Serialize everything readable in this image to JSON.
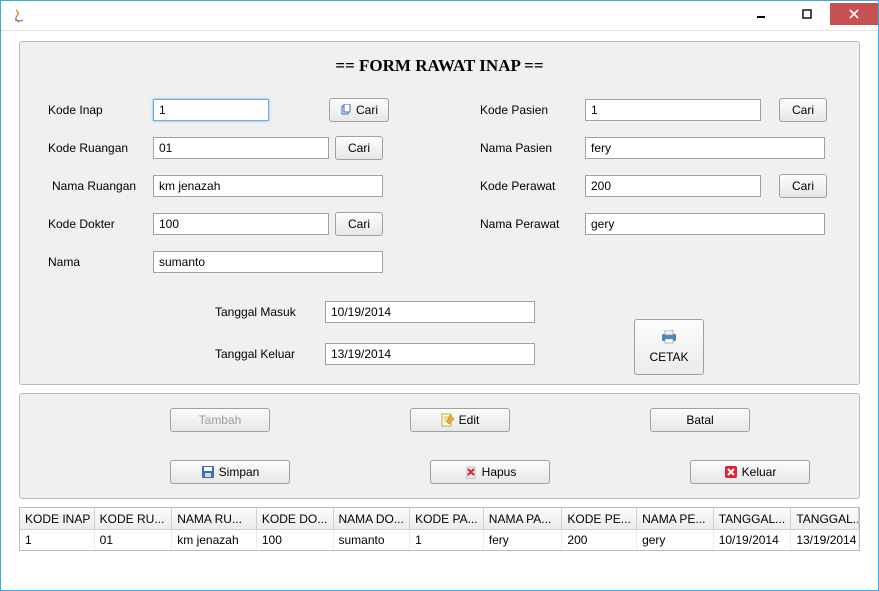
{
  "window": {
    "title": ""
  },
  "form": {
    "title": "== FORM RAWAT INAP ==",
    "left": {
      "kode_inap": {
        "label": "Kode Inap",
        "value": "1",
        "cari": "Cari"
      },
      "kode_ruangan": {
        "label": "Kode Ruangan",
        "value": "01",
        "cari": "Cari"
      },
      "nama_ruangan": {
        "label": "Nama Ruangan",
        "value": "km jenazah"
      },
      "kode_dokter": {
        "label": "Kode Dokter",
        "value": "100",
        "cari": "Cari"
      },
      "nama": {
        "label": "Nama",
        "value": "sumanto"
      }
    },
    "right": {
      "kode_pasien": {
        "label": "Kode Pasien",
        "value": "1",
        "cari": "Cari"
      },
      "nama_pasien": {
        "label": "Nama Pasien",
        "value": "fery"
      },
      "kode_perawat": {
        "label": "Kode Perawat",
        "value": "200",
        "cari": "Cari"
      },
      "nama_perawat": {
        "label": "Nama Perawat",
        "value": "gery"
      }
    },
    "dates": {
      "masuk": {
        "label": "Tanggal Masuk",
        "value": "10/19/2014"
      },
      "keluar": {
        "label": "Tanggal Keluar",
        "value": "13/19/2014"
      }
    },
    "cetak": "CETAK"
  },
  "buttons": {
    "tambah": "Tambah",
    "edit": "Edit",
    "batal": "Batal",
    "simpan": "Simpan",
    "hapus": "Hapus",
    "keluar": "Keluar"
  },
  "table": {
    "headers": [
      "KODE INAP",
      "KODE RU...",
      "NAMA RU...",
      "KODE DO...",
      "NAMA DO...",
      "KODE PA...",
      "NAMA PA...",
      "KODE PE...",
      "NAMA PE...",
      "TANGGAL...",
      "TANGGAL..."
    ],
    "rows": [
      [
        "1",
        "01",
        "km jenazah",
        "100",
        "sumanto",
        "1",
        "fery",
        "200",
        "gery",
        "10/19/2014",
        "13/19/2014"
      ]
    ]
  }
}
